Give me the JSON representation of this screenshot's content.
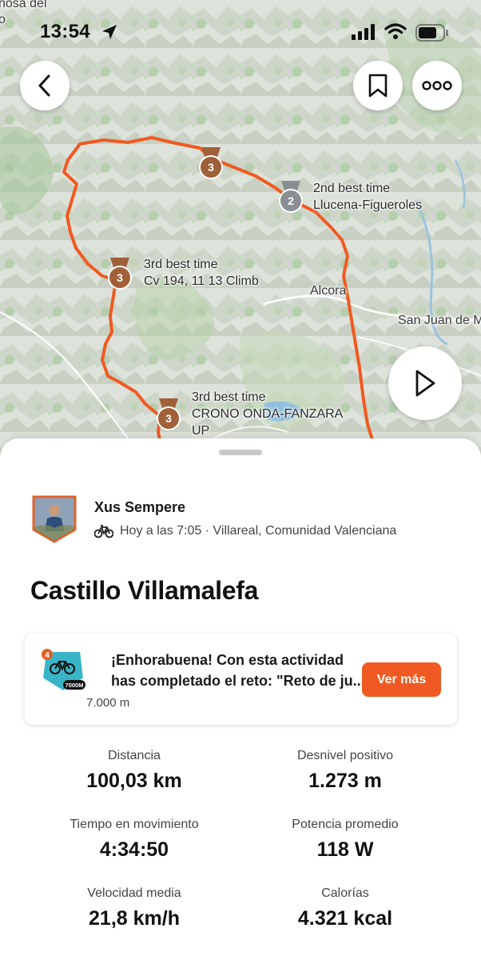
{
  "status_bar": {
    "time": "13:54"
  },
  "map": {
    "place_labels": [
      "nosa del",
      "o",
      "Alcora",
      "San Juan de M"
    ],
    "achievements": [
      {
        "rank": "3",
        "label_line1": "3rd best time",
        "label_line2": "Cv 194, 11 13 Climb"
      },
      {
        "rank": "2",
        "label_line1": "2nd best time",
        "label_line2": "Llucena-Figueroles"
      },
      {
        "rank": "3",
        "label_line1": "3rd best time",
        "label_line2": "CRONO ONDA-FANZARA",
        "label_line3": "UP"
      },
      {
        "rank": "3"
      }
    ],
    "route_color": "#f05a22"
  },
  "athlete": {
    "name": "Xus Sempere",
    "meta": "Hoy a las 7:05 · Villareal, Comunidad Valenciana",
    "sport_icon": "bike-icon"
  },
  "activity": {
    "title": "Castillo Villamalefa"
  },
  "challenge": {
    "line1": "¡Enhorabuena! Con esta actividad",
    "line2": "has completado el reto: \"Reto de ju...",
    "badge_text": "7000M",
    "badge_corner": "4",
    "sub": "7.000 m",
    "button": "Ver más"
  },
  "stats": [
    {
      "label": "Distancia",
      "value": "100,03 km"
    },
    {
      "label": "Desnivel positivo",
      "value": "1.273 m"
    },
    {
      "label": "Tiempo en movimiento",
      "value": "4:34:50"
    },
    {
      "label": "Potencia promedio",
      "value": "118 W"
    },
    {
      "label": "Velocidad media",
      "value": "21,8 km/h"
    },
    {
      "label": "Calorías",
      "value": "4.321 kcal"
    }
  ],
  "colors": {
    "accent": "#f05a22",
    "medal_bronze": "#a0603a",
    "medal_silver": "#8a8f96"
  }
}
